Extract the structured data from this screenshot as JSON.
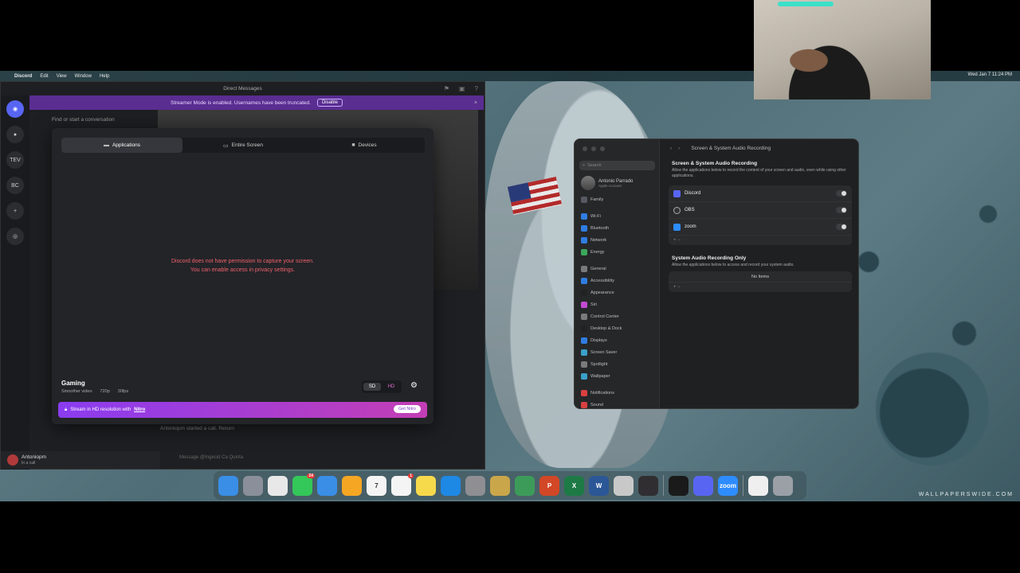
{
  "menubar": {
    "apple": "",
    "app_name": "Discord",
    "items": [
      "Edit",
      "View",
      "Window",
      "Help"
    ],
    "clock": "Wed Jan 7  11:24 PM"
  },
  "discord": {
    "window_title": "Direct Messages",
    "streamer_banner": "Streamer Mode is enabled. Usernames have been truncated.",
    "disable_label": "Disable",
    "close_x": "×",
    "dm_search": "Find or start a conversation",
    "guilds": [
      "TEV",
      "BC"
    ],
    "user_name": "Antoniopm",
    "user_status": "In a call",
    "chat_line": "Antoniopm started a call. Return",
    "chat_placeholder": "Message @Ingecid Ca Quinta",
    "modal": {
      "tabs": [
        {
          "label": "Applications",
          "icon": "window-icon"
        },
        {
          "label": "Entire Screen",
          "icon": "monitor-icon"
        },
        {
          "label": "Devices",
          "icon": "camera-icon"
        }
      ],
      "perm_line1": "Discord does not have permission to capture your screen.",
      "perm_line2": "You can enable access in privacy settings.",
      "gaming_title": "Gaming",
      "gaming_meta": [
        "Smoother video",
        "720p",
        "30fps"
      ],
      "quality_sd": "SD",
      "quality_hd": "HD",
      "nitro_text": "Stream in HD resolution with",
      "nitro_link": "Nitro",
      "nitro_button": "Get Nitro"
    }
  },
  "settings": {
    "search_placeholder": "Search",
    "account_name": "Antonio Parrado",
    "account_sub": "Apple Account",
    "sidebar": [
      {
        "label": "Family",
        "color": "#555a60"
      },
      {
        "label": "Wi-Fi",
        "color": "#2f7de1",
        "gap": true
      },
      {
        "label": "Bluetooth",
        "color": "#2f7de1"
      },
      {
        "label": "Network",
        "color": "#2f7de1"
      },
      {
        "label": "Energy",
        "color": "#3ca65a"
      },
      {
        "label": "General",
        "color": "#7a7a7a",
        "gap": true
      },
      {
        "label": "Accessibility",
        "color": "#2f7de1"
      },
      {
        "label": "Appearance",
        "color": "#222"
      },
      {
        "label": "Siri",
        "color": "#c24ad0"
      },
      {
        "label": "Control Center",
        "color": "#7a7a7a"
      },
      {
        "label": "Desktop & Dock",
        "color": "#222"
      },
      {
        "label": "Displays",
        "color": "#2f7de1"
      },
      {
        "label": "Screen Saver",
        "color": "#3aa0c8"
      },
      {
        "label": "Spotlight",
        "color": "#7a7a7a"
      },
      {
        "label": "Wallpaper",
        "color": "#3aa0c8"
      },
      {
        "label": "Notifications",
        "color": "#d94040",
        "gap": true
      },
      {
        "label": "Sound",
        "color": "#d94040"
      }
    ],
    "page_title": "Screen & System Audio Recording",
    "section1_title": "Screen & System Audio Recording",
    "section1_desc": "Allow the applications below to record the content of your screen and audio, even while using other applications.",
    "apps": [
      {
        "name": "Discord",
        "color": "#5865f2"
      },
      {
        "name": "OBS",
        "color": "#333"
      },
      {
        "name": "zoom",
        "color": "#2d8cff"
      }
    ],
    "list_footer": "+   −",
    "section2_title": "System Audio Recording Only",
    "section2_desc": "Allow the applications below to access and record your system audio.",
    "no_items": "No Items"
  },
  "dock": [
    {
      "name": "finder-icon",
      "label": "",
      "color": "#3a8ee6"
    },
    {
      "name": "launchpad-icon",
      "label": "",
      "color": "#8a8f99"
    },
    {
      "name": "chrome-icon",
      "label": "",
      "color": "#e8e8e8"
    },
    {
      "name": "messages-icon",
      "label": "",
      "color": "#34c759",
      "badge": "24"
    },
    {
      "name": "mail-icon",
      "label": "",
      "color": "#3a8ee6"
    },
    {
      "name": "photos-icon",
      "label": "",
      "color": "#f5a623"
    },
    {
      "name": "calendar-icon",
      "label": "7",
      "color": "#f4f4f4"
    },
    {
      "name": "reminders-icon",
      "label": "",
      "color": "#f4f4f4",
      "badge": "1"
    },
    {
      "name": "notes-icon",
      "label": "",
      "color": "#f7d94c"
    },
    {
      "name": "app-store-icon",
      "label": "",
      "color": "#1e88e5"
    },
    {
      "name": "system-settings-icon",
      "label": "",
      "color": "#8e8e93"
    },
    {
      "name": "archive-icon",
      "label": "",
      "color": "#c9a64a"
    },
    {
      "name": "android-studio-icon",
      "label": "",
      "color": "#3d9b5a"
    },
    {
      "name": "powerpoint-icon",
      "label": "P",
      "color": "#d24726"
    },
    {
      "name": "excel-icon",
      "label": "X",
      "color": "#1d7a45"
    },
    {
      "name": "word-icon",
      "label": "W",
      "color": "#2b5797"
    },
    {
      "name": "script-editor-icon",
      "label": "",
      "color": "#c8c8c8"
    },
    {
      "name": "obs-icon",
      "label": "",
      "color": "#302e31"
    },
    {
      "name": "separator",
      "label": "",
      "color": ""
    },
    {
      "name": "terminal-icon",
      "label": "",
      "color": "#1a1a1a"
    },
    {
      "name": "discord-icon",
      "label": "",
      "color": "#5865f2"
    },
    {
      "name": "zoom-icon",
      "label": "zoom",
      "color": "#2d8cff"
    },
    {
      "name": "separator",
      "label": "",
      "color": ""
    },
    {
      "name": "document-icon",
      "label": "",
      "color": "#efefef"
    },
    {
      "name": "trash-icon",
      "label": "",
      "color": "#9aa0a6"
    }
  ],
  "watermark": "WALLPAPERSWIDE.COM"
}
